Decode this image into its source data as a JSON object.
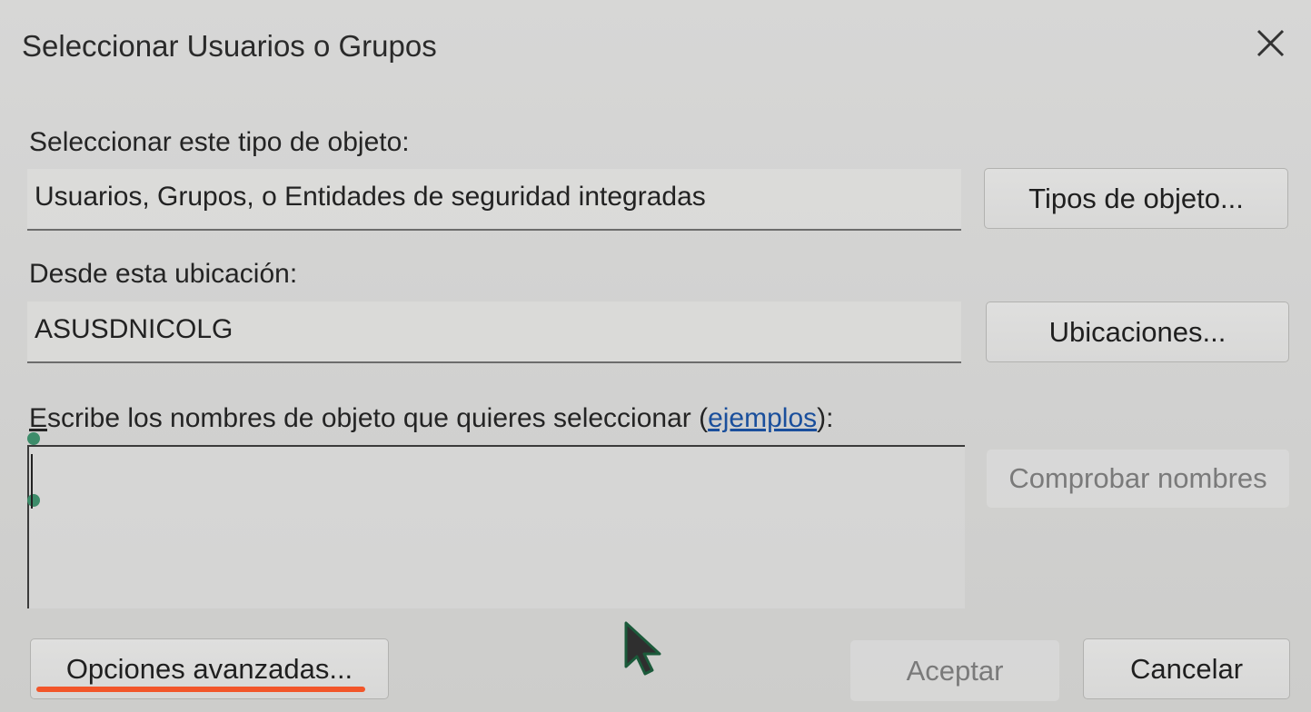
{
  "dialog": {
    "title": "Seleccionar Usuarios o Grupos"
  },
  "object_type": {
    "label": "Seleccionar este tipo de objeto:",
    "value": "Usuarios, Grupos, o Entidades de seguridad integradas",
    "button_label": "Tipos de objeto..."
  },
  "location": {
    "label": "Desde esta ubicación:",
    "value": "ASUSDNICOLG",
    "button_label": "Ubicaciones..."
  },
  "names": {
    "label_prefix_underlined": "E",
    "label_prefix_rest": "scribe los nombres de objeto que quieres seleccionar (",
    "link_text": "ejemplos",
    "label_suffix": "):",
    "value": "",
    "check_button_label": "Comprobar nombres"
  },
  "footer": {
    "advanced_button_label": "Opciones avanzadas...",
    "ok_button_label": "Aceptar",
    "cancel_button_label": "Cancelar"
  },
  "icons": {
    "close": "close-icon",
    "cursor": "mouse-pointer-icon"
  },
  "colors": {
    "link": "#1a4f9c",
    "annotation": "#f2562a",
    "selection_handle": "#3d8c6a"
  }
}
